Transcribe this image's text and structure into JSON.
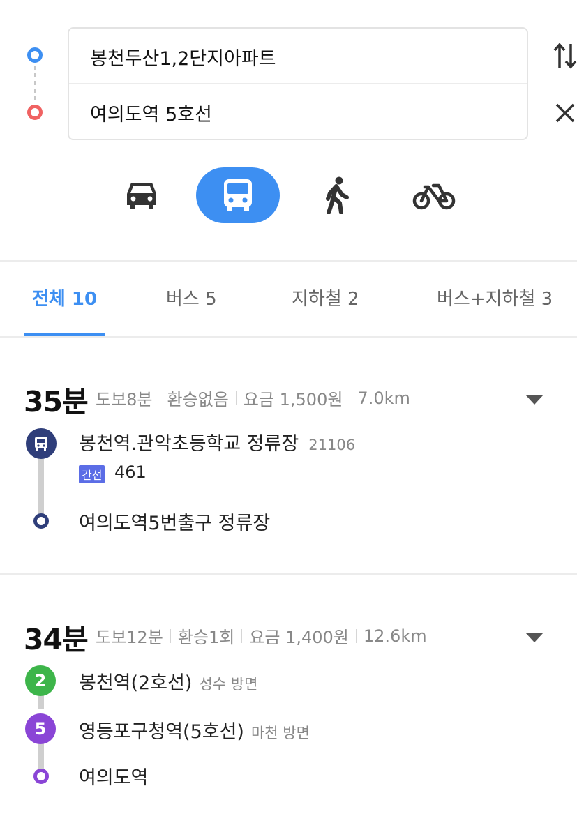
{
  "search": {
    "origin_value": "봉천두산1,2단지아파트",
    "destination_value": "여의도역 5호선"
  },
  "modes": [
    {
      "name": "car",
      "icon": "car-icon"
    },
    {
      "name": "bus",
      "icon": "bus-icon",
      "selected": true
    },
    {
      "name": "walk",
      "icon": "walk-icon"
    },
    {
      "name": "bike",
      "icon": "bike-icon"
    }
  ],
  "tabs": [
    {
      "label": "전체 10",
      "active": true
    },
    {
      "label": "버스 5"
    },
    {
      "label": "지하철 2"
    },
    {
      "label": "버스+지하철 3"
    }
  ],
  "colors": {
    "accent": "#3d8ff2",
    "origin_dot": "#3d8ff2",
    "dest_dot": "#f06262",
    "bus_navy": "#2f3e7a",
    "line2_green": "#3db54a",
    "line5_purple": "#8a45d6",
    "badge_blue": "#5b6de6"
  },
  "routes": [
    {
      "time": "35분",
      "walk": "도보8분",
      "transfer": "환승없음",
      "fare": "요금 1,500원",
      "distance": "7.0km",
      "start_stop": "봉천역.관악초등학교 정류장",
      "start_stop_id": "21106",
      "bus_badge": "간선",
      "bus_number": "461",
      "end_stop": "여의도역5번출구 정류장"
    },
    {
      "time": "34분",
      "walk": "도보12분",
      "transfer": "환승1회",
      "fare": "요금 1,400원",
      "distance": "12.6km",
      "leg1_line": "2",
      "leg1_station": "봉천역(2호선)",
      "leg1_direction": "성수 방면",
      "leg2_line": "5",
      "leg2_station": "영등포구청역(5호선)",
      "leg2_direction": "마천 방면",
      "end_station": "여의도역"
    }
  ]
}
